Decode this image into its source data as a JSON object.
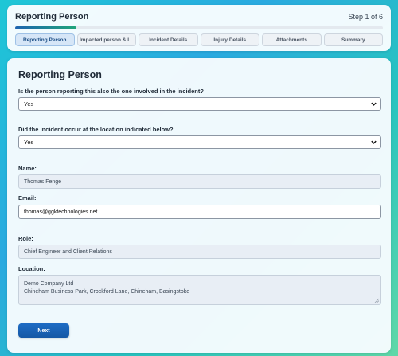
{
  "header": {
    "title": "Reporting Person",
    "step": "Step 1 of 6",
    "progress_fraction": 0.1667
  },
  "tabs": [
    {
      "label": "Reporting Person",
      "active": true
    },
    {
      "label": "Impacted person & I...",
      "active": false
    },
    {
      "label": "Incident Details",
      "active": false
    },
    {
      "label": "Injury Details",
      "active": false
    },
    {
      "label": "Attachments",
      "active": false
    },
    {
      "label": "Summary",
      "active": false
    }
  ],
  "form": {
    "section_title": "Reporting Person",
    "q1_label": "Is the person reporting this also the one involved in the incident?",
    "q1_value": "Yes",
    "q2_label": "Did the incident occur at the location indicated below?",
    "q2_value": "Yes",
    "name_label": "Name:",
    "name_value": "Thomas Fenge",
    "email_label": "Email:",
    "email_value": "thomas@ggktechnologies.net",
    "role_label": "Role:",
    "role_value": "Chief Engineer and Client Relations",
    "location_label": "Location:",
    "location_line1": "Demo Company Ltd",
    "location_line2": "Chineham Business Park, Crockford Lane, Chineham, Basingstoke",
    "next_label": "Next"
  },
  "icons": {
    "select_arrow": "chevron-down-icon",
    "textarea_resize": "resize-handle-icon"
  },
  "colors": {
    "primary_button": "#1558a6",
    "progress_start": "#1e64b0",
    "progress_end": "#1fa57a"
  }
}
